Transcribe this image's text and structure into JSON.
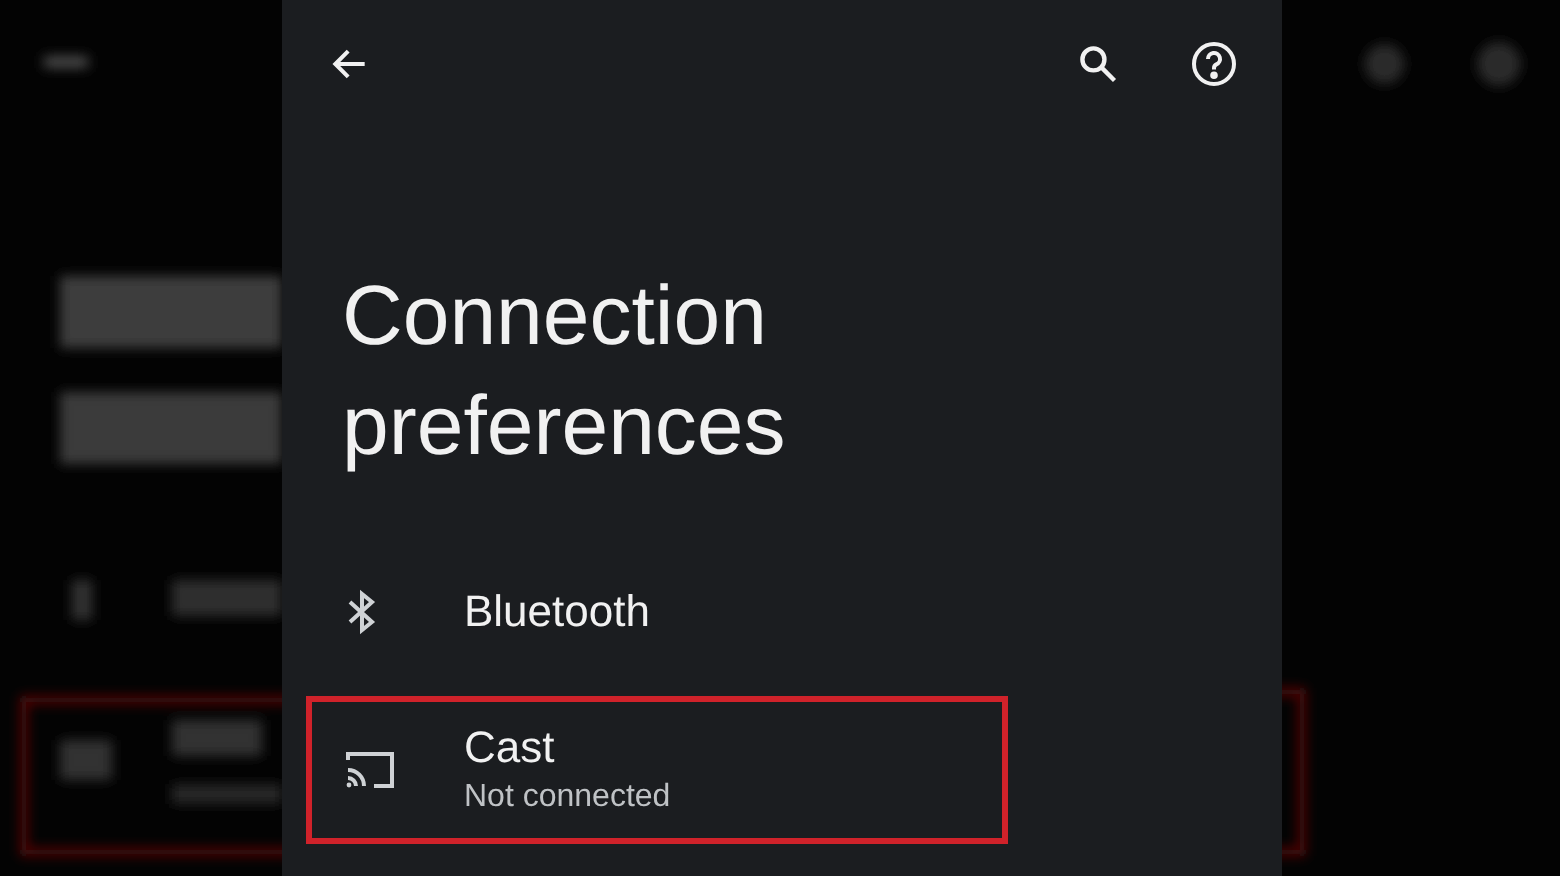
{
  "title": "Connection preferences",
  "items": [
    {
      "kind": "bluetooth",
      "label": "Bluetooth",
      "highlighted": false
    },
    {
      "kind": "cast",
      "label": "Cast",
      "summary": "Not connected",
      "highlighted": true
    }
  ]
}
